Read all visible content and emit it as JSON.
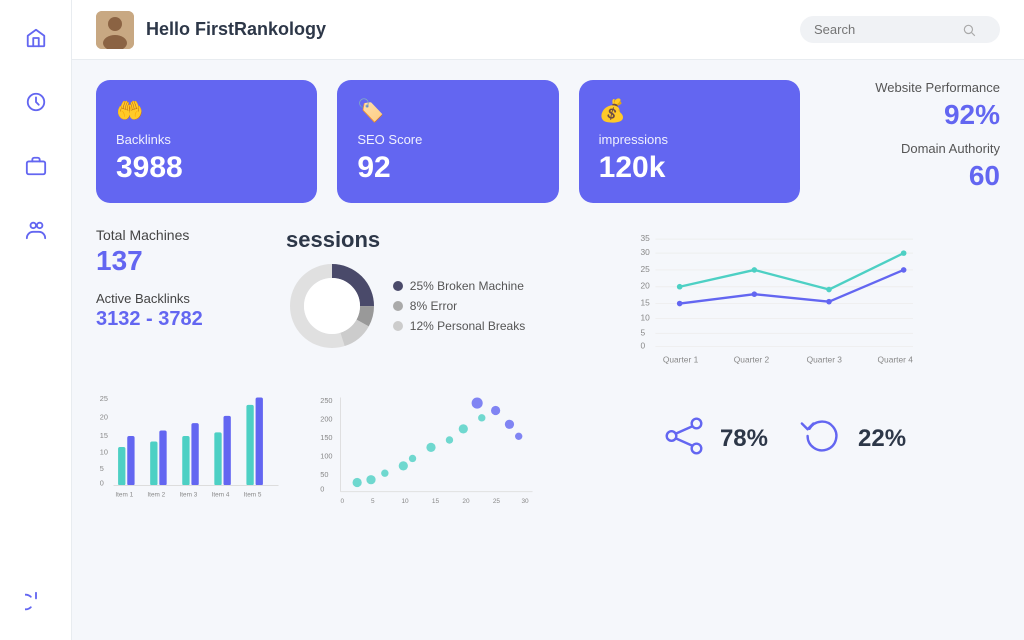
{
  "header": {
    "greeting": "Hello FirstRankology",
    "search_placeholder": "Search"
  },
  "sidebar": {
    "icons": [
      "home",
      "dashboard",
      "briefcase",
      "users",
      "power"
    ]
  },
  "cards": [
    {
      "label": "Backlinks",
      "value": "3988",
      "icon": "hands"
    },
    {
      "label": "SEO Score",
      "value": "92",
      "icon": "tag"
    },
    {
      "label": "impressions",
      "value": "120k",
      "icon": "coin"
    }
  ],
  "website_performance": {
    "label": "Website Performance",
    "value": "92%",
    "da_label": "Domain Authority",
    "da_value": "60"
  },
  "machines": {
    "label": "Total Machines",
    "value": "137",
    "backlinks_label": "Active Backlinks",
    "backlinks_value": "3132 - 3782"
  },
  "sessions": {
    "title": "sessions",
    "legend": [
      {
        "label": "25% Broken Machine",
        "color": "#4a4a6a"
      },
      {
        "label": "8% Error",
        "color": "#aaaaaa"
      },
      {
        "label": "12% Personal Breaks",
        "color": "#cccccc"
      }
    ]
  },
  "line_chart": {
    "quarters": [
      "Quarter 1",
      "Quarter 2",
      "Quarter 3",
      "Quarter 4"
    ],
    "y_labels": [
      "0",
      "5",
      "10",
      "15",
      "20",
      "25",
      "30",
      "35"
    ]
  },
  "bar_chart": {
    "items": [
      "Item 1",
      "Item 2",
      "Item 3",
      "Item 4",
      "Item 5"
    ],
    "y_labels": [
      "0",
      "5",
      "10",
      "15",
      "20",
      "25"
    ]
  },
  "scatter_chart": {
    "x_labels": [
      "0",
      "5",
      "10",
      "15",
      "20",
      "25",
      "30"
    ],
    "y_labels": [
      "0",
      "50",
      "100",
      "150",
      "200",
      "250"
    ]
  },
  "metrics": [
    {
      "icon": "share",
      "value": "78%"
    },
    {
      "icon": "refresh",
      "value": "22%"
    }
  ]
}
